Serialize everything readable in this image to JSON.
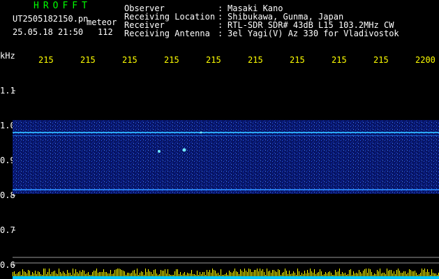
{
  "header": {
    "title": "HROFFT",
    "filename": "UT2505182150.pn",
    "meteor_label": "meteor",
    "datetime": "25.05.18 21:50",
    "count": "112"
  },
  "info": [
    {
      "label": "Observer",
      "value": "Masaki Kano"
    },
    {
      "label": "Receiving Location",
      "value": "Shibukawa, Gunma, Japan"
    },
    {
      "label": "Receiver",
      "value": "RTL-SDR SDR# 43dB L15 103.2MHz CW"
    },
    {
      "label": "Receiving Antenna",
      "value": "3el Yagi(V) Az 330 for Vladivostok"
    }
  ],
  "axis": {
    "y_unit": "kHz",
    "y_ticks": [
      "1.1",
      "1.0",
      "0.9",
      "0.8",
      "0.7",
      "0.6"
    ],
    "x_ticks": [
      "215",
      "215",
      "215",
      "215",
      "215",
      "215",
      "215",
      "215",
      "215",
      "2200"
    ]
  },
  "colors": {
    "text_white": "#ffffff",
    "text_yellow": "#ffff00",
    "text_green": "#00ff00",
    "background": "#000000",
    "noise_band": "#0a1c8c",
    "signal_line": "#38d0ff",
    "bottom_bars": "#ffff00"
  }
}
